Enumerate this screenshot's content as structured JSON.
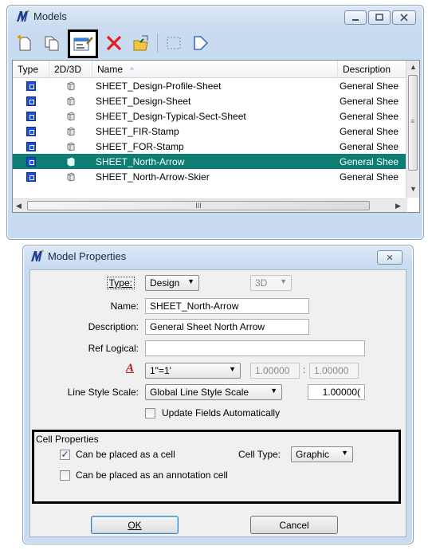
{
  "models_window": {
    "title": "Models",
    "toolbar_icons": [
      "create-model-icon",
      "copy-model-icon",
      "edit-model-properties-icon",
      "delete-model-icon",
      "import-model-icon",
      "select-icon",
      "arrow-shape-icon"
    ],
    "columns": {
      "type": "Type",
      "dim": "2D/3D",
      "name": "Name",
      "description": "Description"
    },
    "rows": [
      {
        "name": "SHEET_Design-Profile-Sheet",
        "description": "General Shee"
      },
      {
        "name": "SHEET_Design-Sheet",
        "description": "General Shee"
      },
      {
        "name": "SHEET_Design-Typical-Sect-Sheet",
        "description": "General Shee"
      },
      {
        "name": "SHEET_FIR-Stamp",
        "description": "General Shee"
      },
      {
        "name": "SHEET_FOR-Stamp",
        "description": "General Shee"
      },
      {
        "name": "SHEET_North-Arrow",
        "description": "General Shee",
        "selected": true
      },
      {
        "name": "SHEET_North-Arrow-Skier",
        "description": "General Shee"
      }
    ],
    "hscroll_grip": "III"
  },
  "model_properties": {
    "title": "Model Properties",
    "close_glyph": "✕",
    "type_label": "Type:",
    "type_value": "Design",
    "dim_value": "3D",
    "name_label": "Name:",
    "name_value": "SHEET_North-Arrow",
    "description_label": "Description:",
    "description_value": "General Sheet North Arrow",
    "ref_logical_label": "Ref Logical:",
    "ref_logical_value": "",
    "annotation_scale_value": "1\"=1'",
    "scale_a": "1.00000",
    "scale_sep": ":",
    "scale_b": "1.00000",
    "line_style_scale_label": "Line Style Scale:",
    "line_style_scale_value": "Global Line Style Scale",
    "line_style_scale_number": "1.00000(",
    "update_fields_label": "Update Fields Automatically",
    "update_fields_checked": false,
    "cell_properties_label": "Cell Properties",
    "placed_as_cell_label": "Can be placed as a cell",
    "placed_as_cell_checked": true,
    "cell_type_label": "Cell Type:",
    "cell_type_value": "Graphic",
    "annotation_cell_label": "Can be placed as an annotation cell",
    "annotation_cell_checked": false,
    "ok_label": "OK",
    "cancel_label": "Cancel"
  }
}
